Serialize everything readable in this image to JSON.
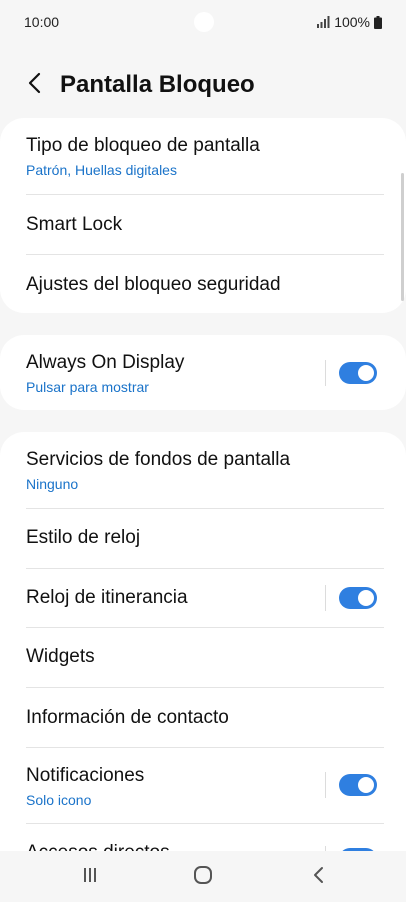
{
  "status_bar": {
    "time": "10:00",
    "battery": "100%"
  },
  "header": {
    "title": "Pantalla Bloqueo"
  },
  "cards": [
    [
      {
        "title": "Tipo de bloqueo de pantalla",
        "subtitle": "Patrón, Huellas digitales"
      },
      {
        "title": "Smart Lock"
      },
      {
        "title": "Ajustes del bloqueo seguridad"
      }
    ],
    [
      {
        "title": "Always On Display",
        "subtitle": "Pulsar para mostrar",
        "toggle": true
      }
    ],
    [
      {
        "title": "Servicios de fondos de pantalla",
        "subtitle": "Ninguno"
      },
      {
        "title": "Estilo de reloj"
      },
      {
        "title": "Reloj de itinerancia",
        "toggle": true
      },
      {
        "title": "Widgets"
      },
      {
        "title": "Información de contacto"
      },
      {
        "title": "Notificaciones",
        "subtitle": "Solo icono",
        "toggle": true
      },
      {
        "title": "Accesos directos",
        "toggle": true
      }
    ]
  ],
  "icons": {
    "back": "chevron-left-icon",
    "signal": "signal-icon",
    "battery": "battery-icon",
    "recents": "recents-icon",
    "home": "home-icon",
    "nav_back": "nav-back-icon"
  },
  "colors": {
    "accent": "#2f7fe0",
    "subtitle": "#1a73c9",
    "background": "#f6f6f6"
  }
}
